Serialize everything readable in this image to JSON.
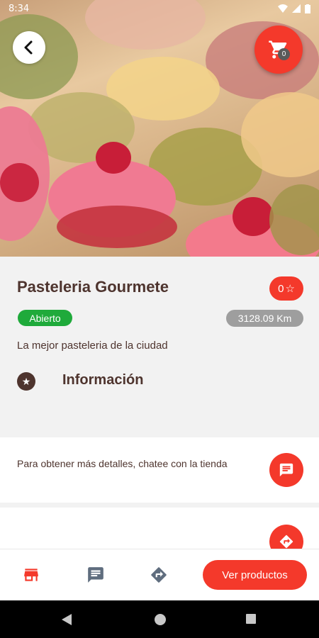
{
  "status_bar": {
    "time": "8:34"
  },
  "cart": {
    "count": "0"
  },
  "store": {
    "name": "Pasteleria Gourmete",
    "rating": "0",
    "status": "Abierto",
    "distance": "3128.09 Km",
    "description": "La mejor pasteleria de la ciudad"
  },
  "info": {
    "title": "Información"
  },
  "chat": {
    "text": "Para obtener más detalles, chatee con la tienda"
  },
  "bottom_nav": {
    "products_label": "Ver productos"
  },
  "colors": {
    "accent": "#f4392b",
    "text": "#4e342e",
    "open": "#1faa3b",
    "distance_bg": "#9e9e9e"
  }
}
